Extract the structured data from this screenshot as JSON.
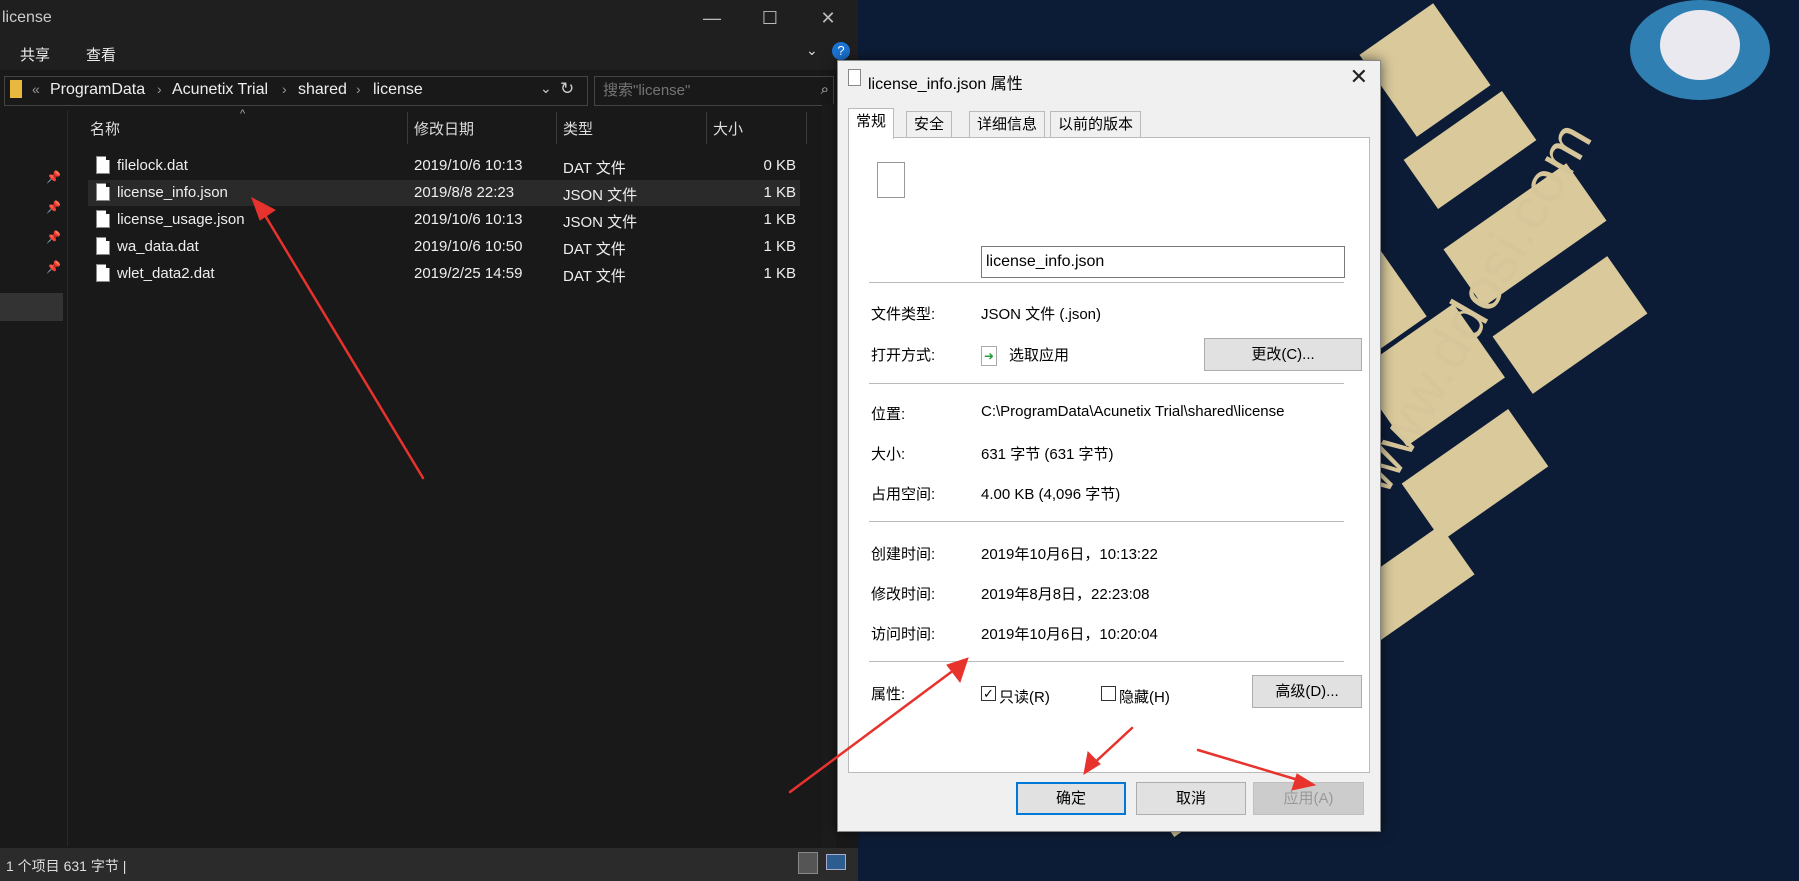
{
  "window": {
    "title": "license",
    "controls": {
      "minimize": "—",
      "maximize": "☐",
      "close": "✕"
    }
  },
  "ribbon": {
    "tabs": [
      "共享",
      "查看"
    ]
  },
  "address": {
    "overflow": "«",
    "crumbs": [
      "ProgramData",
      "Acunetix Trial",
      "shared",
      "license"
    ]
  },
  "search": {
    "placeholder": "搜索\"license\""
  },
  "columns": {
    "name": "名称",
    "modified": "修改日期",
    "type": "类型",
    "size": "大小"
  },
  "files": [
    {
      "name": "filelock.dat",
      "modified": "2019/10/6 10:13",
      "type": "DAT 文件",
      "size": "0 KB"
    },
    {
      "name": "license_info.json",
      "modified": "2019/8/8 22:23",
      "type": "JSON 文件",
      "size": "1 KB"
    },
    {
      "name": "license_usage.json",
      "modified": "2019/10/6 10:13",
      "type": "JSON 文件",
      "size": "1 KB"
    },
    {
      "name": "wa_data.dat",
      "modified": "2019/10/6 10:50",
      "type": "DAT 文件",
      "size": "1 KB"
    },
    {
      "name": "wlet_data2.dat",
      "modified": "2019/2/25 14:59",
      "type": "DAT 文件",
      "size": "1 KB"
    }
  ],
  "status": {
    "text": "1 个项目   631 字节  |"
  },
  "dialog": {
    "title": "license_info.json 属性",
    "tabs": [
      "常规",
      "安全",
      "详细信息",
      "以前的版本"
    ],
    "filename": "license_info.json",
    "file_type_label": "文件类型:",
    "file_type_value": "JSON 文件 (.json)",
    "open_with_label": "打开方式:",
    "open_with_value": "选取应用",
    "change_button": "更改(C)...",
    "location_label": "位置:",
    "location_value": "C:\\ProgramData\\Acunetix Trial\\shared\\license",
    "size_label": "大小:",
    "size_value": "631 字节 (631 字节)",
    "disk_label": "占用空间:",
    "disk_value": "4.00 KB (4,096 字节)",
    "created_label": "创建时间:",
    "created_value": "2019年10月6日，10:13:22",
    "modified_label": "修改时间:",
    "modified_value": "2019年8月8日，22:23:08",
    "accessed_label": "访问时间:",
    "accessed_value": "2019年10月6日，10:20:04",
    "attributes_label": "属性:",
    "readonly_label": "只读(R)",
    "readonly_checked": true,
    "hidden_label": "隐藏(H)",
    "hidden_checked": false,
    "advanced_button": "高级(D)...",
    "ok_button": "确定",
    "cancel_button": "取消",
    "apply_button": "应用(A)"
  },
  "wallpaper": {
    "watermark": "www.ddosi.com"
  },
  "colors": {
    "accent": "#0078d7",
    "annotation": "#e8322d",
    "wallpaper_gold": "#d9c99b"
  }
}
